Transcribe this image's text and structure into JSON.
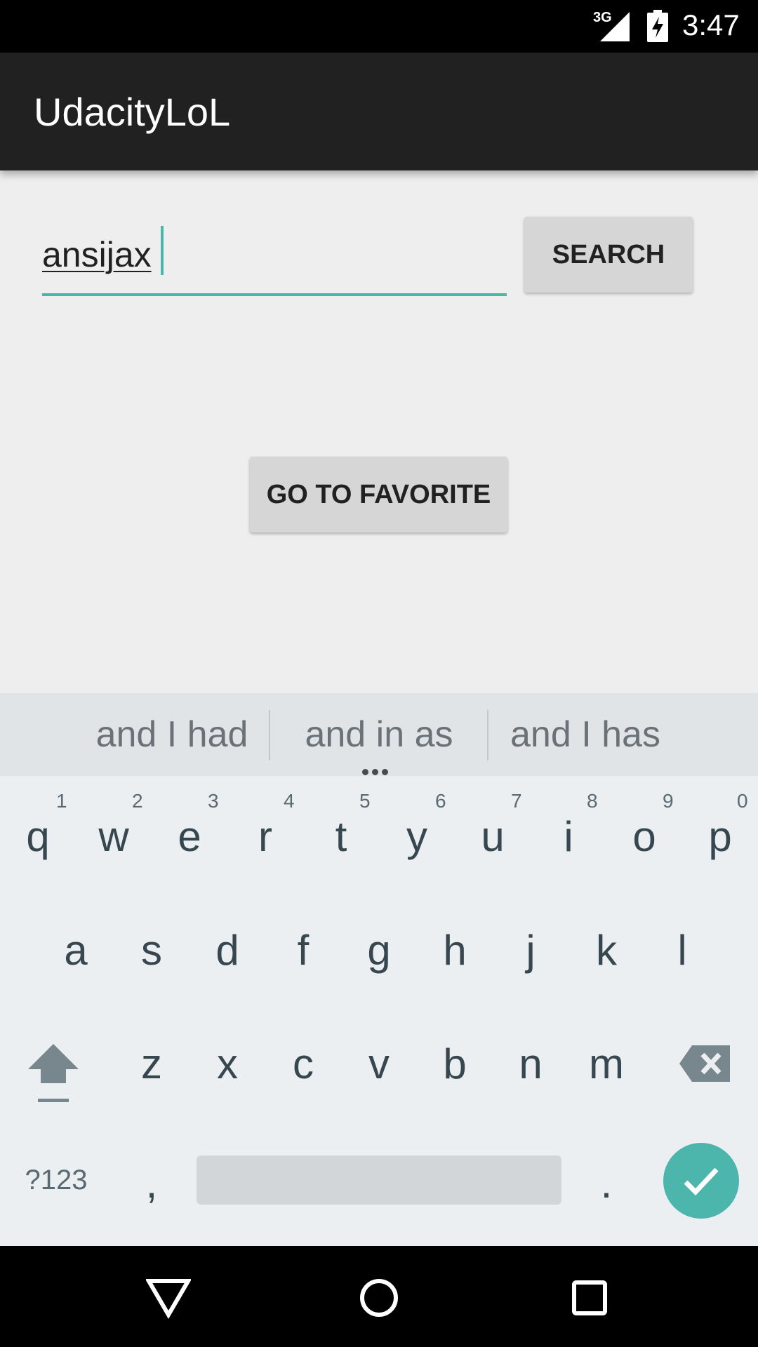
{
  "status_bar": {
    "network_label": "3G",
    "time": "3:47",
    "icons": [
      "signal-icon",
      "battery-charging-icon"
    ]
  },
  "app_bar": {
    "title": "UdacityLoL"
  },
  "search": {
    "value": "ansijax",
    "button_label": "SEARCH"
  },
  "favorite": {
    "button_label": "GO TO FAVORITE"
  },
  "keyboard": {
    "suggestions": [
      "and I had",
      "and in as",
      "and I has"
    ],
    "row1": [
      {
        "char": "q",
        "hint": "1"
      },
      {
        "char": "w",
        "hint": "2"
      },
      {
        "char": "e",
        "hint": "3"
      },
      {
        "char": "r",
        "hint": "4"
      },
      {
        "char": "t",
        "hint": "5"
      },
      {
        "char": "y",
        "hint": "6"
      },
      {
        "char": "u",
        "hint": "7"
      },
      {
        "char": "i",
        "hint": "8"
      },
      {
        "char": "o",
        "hint": "9"
      },
      {
        "char": "p",
        "hint": "0"
      }
    ],
    "row2": [
      "a",
      "s",
      "d",
      "f",
      "g",
      "h",
      "j",
      "k",
      "l"
    ],
    "row3": [
      "z",
      "x",
      "c",
      "v",
      "b",
      "n",
      "m"
    ],
    "symbols_label": "?123",
    "comma": ",",
    "period": ".",
    "icons": [
      "shift-icon",
      "backspace-icon",
      "enter-check-icon"
    ]
  },
  "nav_bar": {
    "icons": [
      "back-icon",
      "home-icon",
      "recents-icon"
    ]
  },
  "colors": {
    "accent": "#4db6ac",
    "app_bar": "#212121",
    "background": "#eeeeee"
  }
}
